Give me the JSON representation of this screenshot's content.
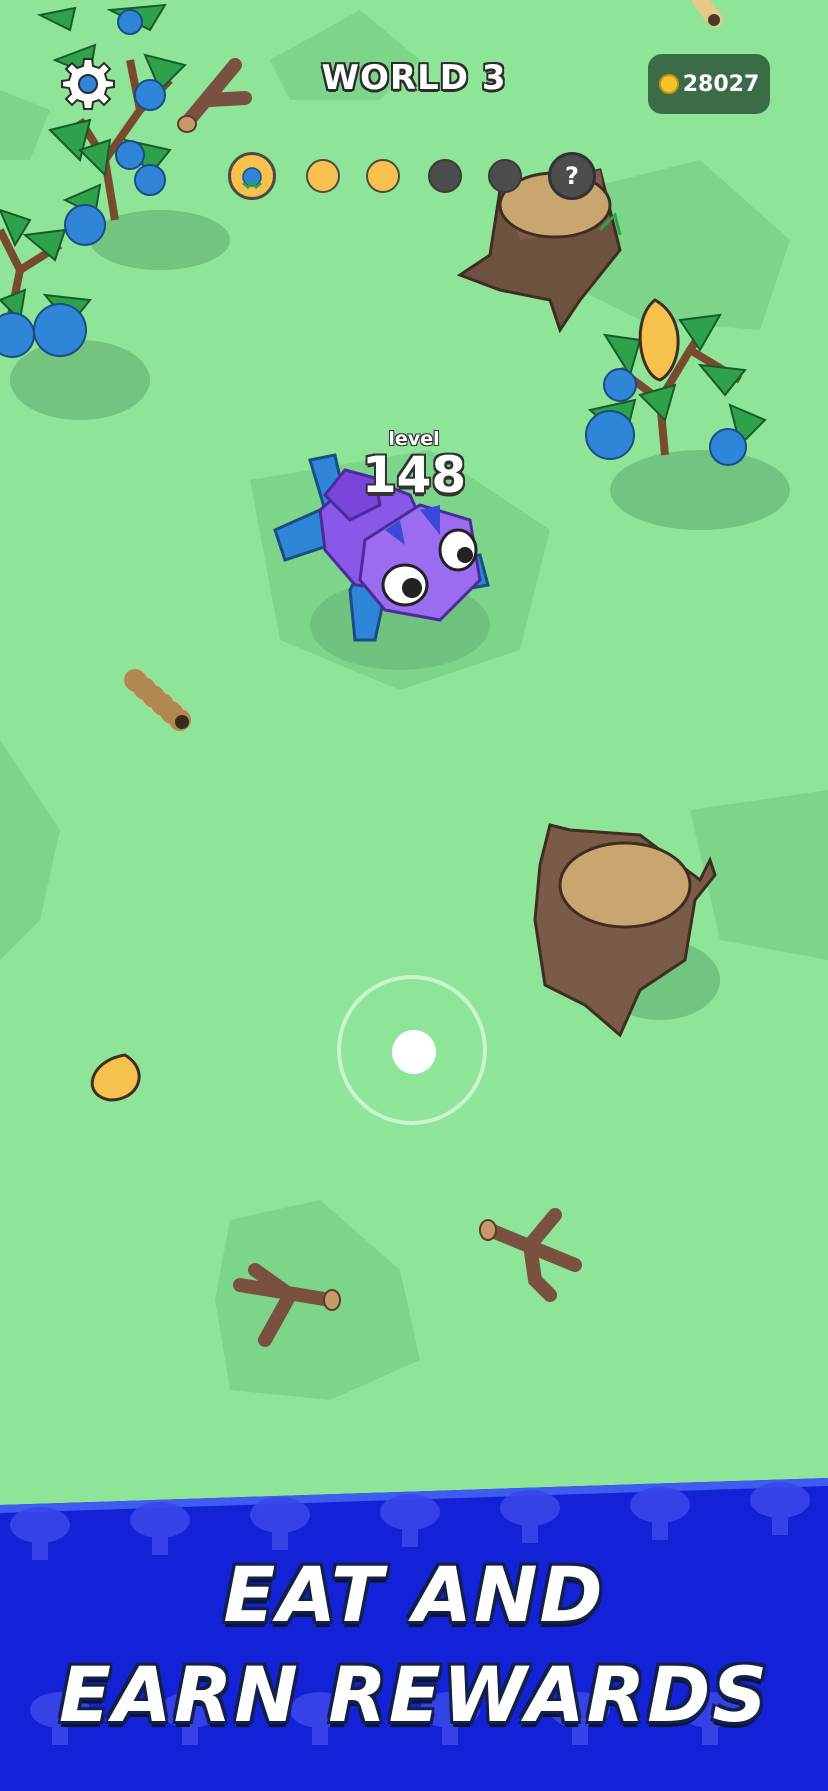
{
  "hud": {
    "world_title": "WORLD 3",
    "coins": "28027",
    "settings_icon": "gear-icon",
    "coin_icon": "coin-icon"
  },
  "progress": {
    "stages": [
      "current",
      "done",
      "done",
      "locked",
      "locked",
      "mystery"
    ],
    "mystery_label": "?"
  },
  "player": {
    "level_label": "level",
    "level_value": "148"
  },
  "banner": {
    "line1": "EAT AND",
    "line2": "EARN REWARDS"
  },
  "colors": {
    "grass": "#8ee597",
    "banner_blue": "#1322d6",
    "creature_purple": "#8a58e8",
    "creature_blue": "#2f8ee8",
    "stump_brown": "#7a5b47",
    "coin_gold": "#f5c42b"
  }
}
